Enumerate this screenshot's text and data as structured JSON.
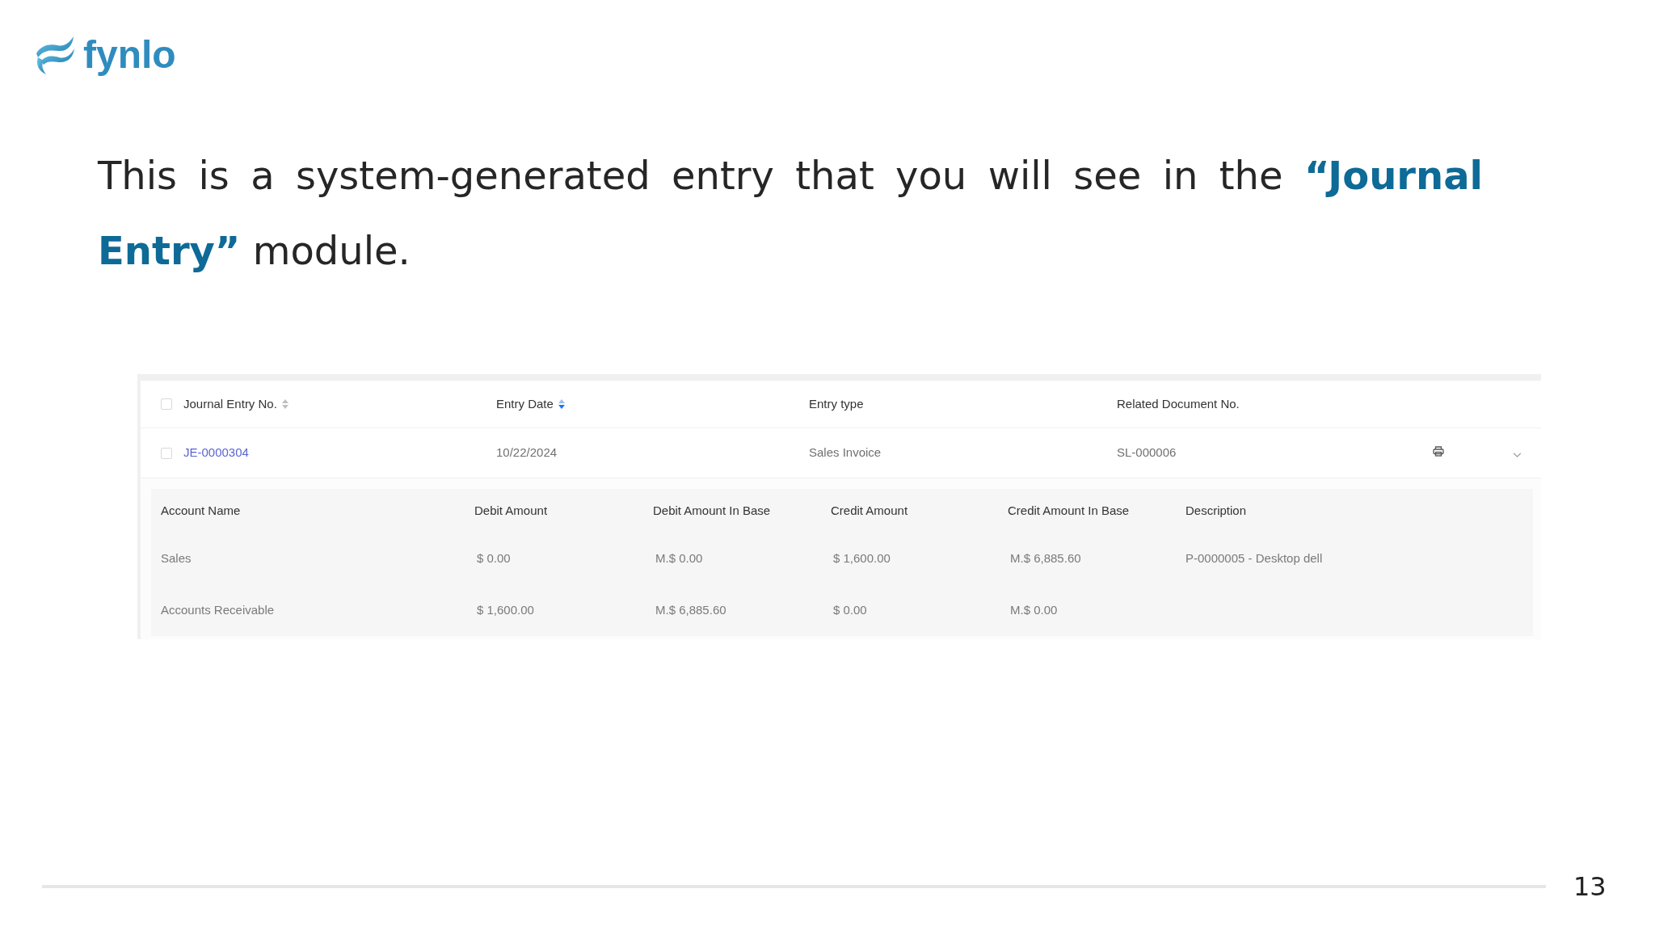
{
  "logo": {
    "text": "fynlo"
  },
  "intro": "This is a system-generated entry that you will see in the **“Journal Entry”** module.",
  "journal_table": {
    "select_all": {
      "checked": false
    },
    "columns": [
      {
        "label": "Journal Entry No.",
        "sortable": true,
        "sorted": false
      },
      {
        "label": "Entry Date",
        "sortable": true,
        "sorted": true
      },
      {
        "label": "Entry type",
        "sortable": false
      },
      {
        "label": "Related Document No.",
        "sortable": false
      }
    ],
    "rows": [
      {
        "checked": false,
        "expanded": true,
        "cells": [
          {
            "kind": "link",
            "text": "JE-0000304"
          },
          {
            "kind": "text",
            "text": "10/22/2024"
          },
          {
            "kind": "text",
            "text": "Sales Invoice"
          },
          {
            "kind": "text",
            "text": "SL-000006"
          }
        ],
        "lines": {
          "columns": [
            "Account Name",
            "Debit Amount",
            "Debit Amount In Base",
            "Credit Amount",
            "Credit Amount In Base",
            "Description"
          ],
          "rows": [
            [
              "Sales",
              "$ 0.00",
              "M.$ 0.00",
              "$ 1,600.00",
              "M.$ 6,885.60",
              "P-0000005 - Desktop dell"
            ],
            [
              "Accounts Receivable",
              "$ 1,600.00",
              "M.$ 6,885.60",
              "$ 0.00",
              "M.$ 0.00"
            ]
          ]
        }
      }
    ]
  },
  "page_number": "13"
}
